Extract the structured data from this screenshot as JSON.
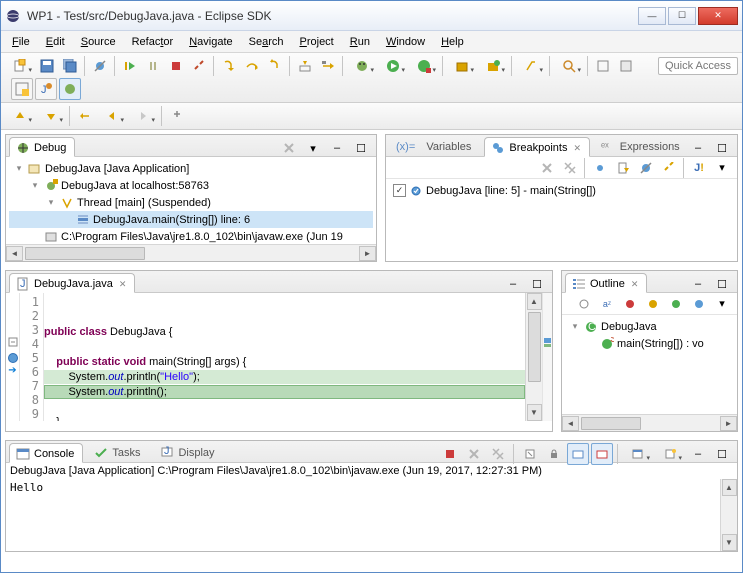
{
  "window": {
    "title": "WP1 - Test/src/DebugJava.java - Eclipse SDK"
  },
  "menu": {
    "file": "File",
    "edit": "Edit",
    "source": "Source",
    "refactor": "Refactor",
    "navigate": "Navigate",
    "search": "Search",
    "project": "Project",
    "run": "Run",
    "window": "Window",
    "help": "Help"
  },
  "quick_access": "Quick Access",
  "debug_view": {
    "title": "Debug",
    "tree": {
      "root": "DebugJava [Java Application]",
      "target": "DebugJava at localhost:58763",
      "thread": "Thread [main] (Suspended)",
      "frame": "DebugJava.main(String[]) line: 6",
      "process": "C:\\Program Files\\Java\\jre1.8.0_102\\bin\\javaw.exe (Jun 19"
    }
  },
  "vars_tab": "Variables",
  "breakpoints_view": {
    "title": "Breakpoints",
    "item": "DebugJava [line: 5] - main(String[])"
  },
  "expr_tab": "Expressions",
  "editor": {
    "filename": "DebugJava.java",
    "lines": {
      "l1": "",
      "l2_pre": "public class",
      "l2_post": " DebugJava {",
      "l3": "",
      "l4_pre": "    public static void",
      "l4_post": " main(String[] args) {",
      "l5_a": "        System.",
      "l5_b": "out",
      "l5_c": ".println(",
      "l5_d": "\"Hello\"",
      "l5_e": ");",
      "l6_a": "        System.",
      "l6_b": "out",
      "l6_c": ".println();",
      "l7": "",
      "l8": "    }",
      "l9": ""
    }
  },
  "outline": {
    "title": "Outline",
    "class": "DebugJava",
    "method": "main(String[]) : vo"
  },
  "console": {
    "tab_console": "Console",
    "tab_tasks": "Tasks",
    "tab_display": "Display",
    "header": "DebugJava [Java Application] C:\\Program Files\\Java\\jre1.8.0_102\\bin\\javaw.exe (Jun 19, 2017, 12:27:31 PM)",
    "output": "Hello"
  }
}
